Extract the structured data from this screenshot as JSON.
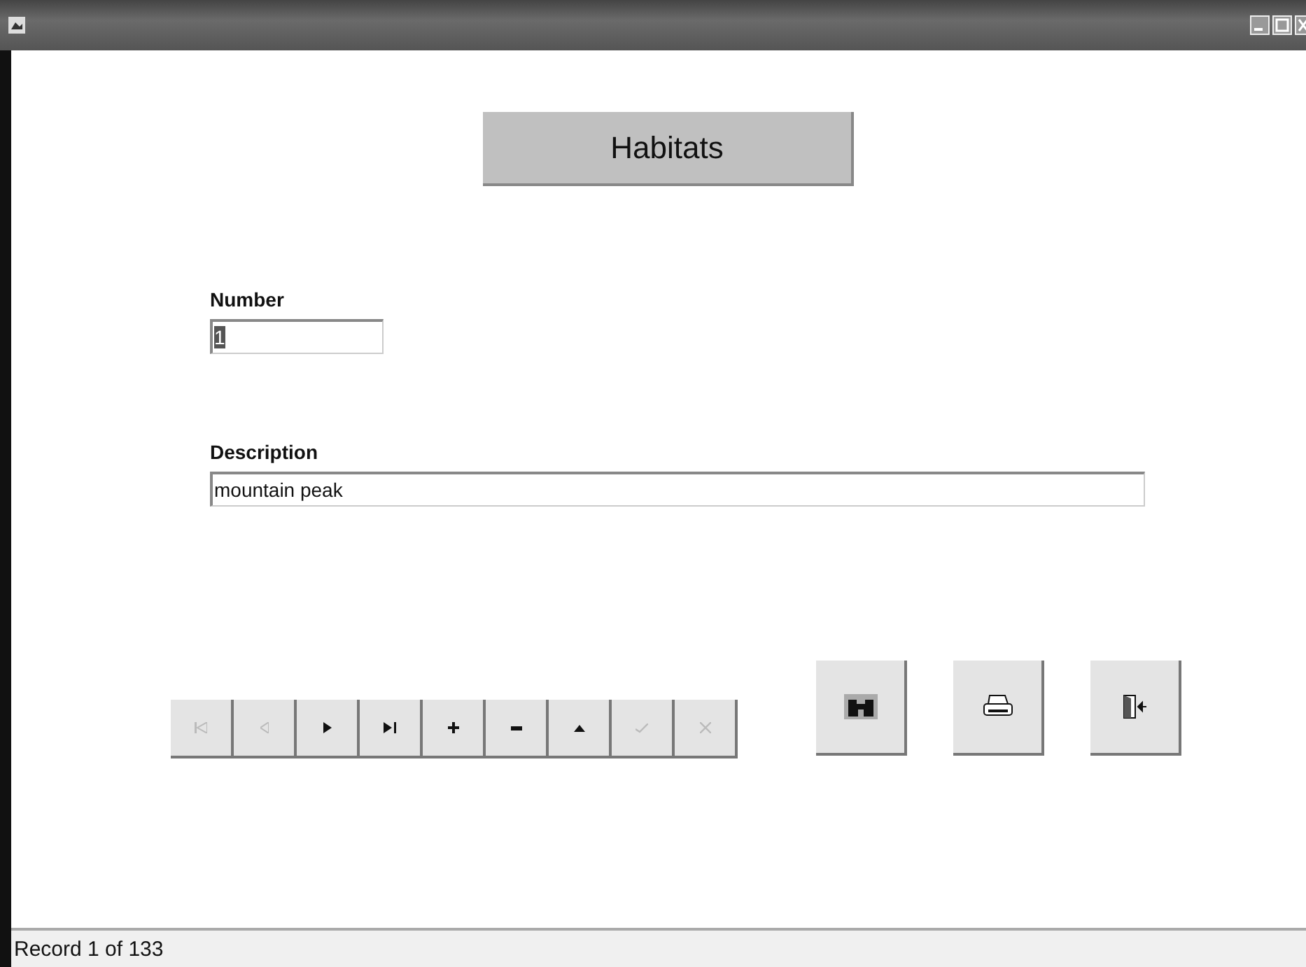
{
  "title_box": {
    "text": "Habitats"
  },
  "fields": [
    {
      "label": "Number",
      "value": "1",
      "text_selected": true,
      "kind": "short"
    },
    {
      "label": "Description",
      "value": "mountain peak",
      "text_selected": false,
      "kind": "wide"
    }
  ],
  "nav_buttons": [
    {
      "kind": "first",
      "disabled": true
    },
    {
      "kind": "prev",
      "disabled": true
    },
    {
      "kind": "next",
      "disabled": false
    },
    {
      "kind": "last",
      "disabled": false
    },
    {
      "kind": "add",
      "disabled": false
    },
    {
      "kind": "delete",
      "disabled": false
    },
    {
      "kind": "up",
      "disabled": false
    },
    {
      "kind": "save",
      "disabled": true
    },
    {
      "kind": "cancel",
      "disabled": true
    }
  ],
  "action_buttons": [
    {
      "kind": "find"
    },
    {
      "kind": "print"
    },
    {
      "kind": "exit"
    }
  ],
  "status_bar": {
    "text": "Record 1 of 133"
  }
}
